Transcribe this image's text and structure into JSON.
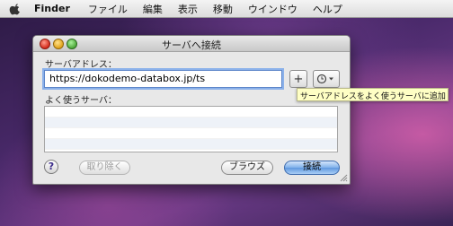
{
  "menubar": {
    "app_name": "Finder",
    "items": [
      "ファイル",
      "編集",
      "表示",
      "移動",
      "ウインドウ",
      "ヘルプ"
    ]
  },
  "window": {
    "title": "サーバへ接続",
    "server_address_label": "サーバアドレス：",
    "server_address_value": "https://dokodemo-databox.jp/ts",
    "add_button": "+",
    "favorites_label": "よく使うサーバ：",
    "help_button": "?",
    "remove_button": "取り除く",
    "browse_button": "ブラウズ",
    "connect_button": "接続"
  },
  "tooltip": "サーバアドレスをよく使うサーバに追加します"
}
